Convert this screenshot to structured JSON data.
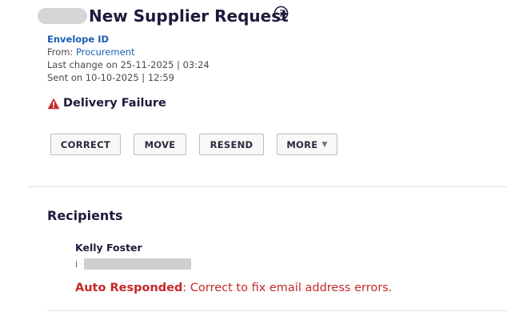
{
  "header": {
    "title": "New Supplier Request",
    "envelope_id_label": "Envelope ID",
    "from_label": "From: ",
    "from_value": "Procurement",
    "last_change": "Last change on 25-11-2025 | 03:24",
    "sent_on": "Sent on 10-10-2025 | 12:59"
  },
  "status": {
    "label": "Delivery Failure",
    "icon": "warning-icon",
    "color": "#c62828"
  },
  "actions": {
    "correct": "CORRECT",
    "move": "MOVE",
    "resend": "RESEND",
    "more": "MORE"
  },
  "recipients": {
    "heading": "Recipients",
    "items": [
      {
        "name": "Kelly Foster",
        "email_visible_start": "i",
        "status_label": "Auto Responded",
        "status_message": ": Correct to fix email address errors."
      }
    ]
  },
  "colors": {
    "accent": "#1a5fb4",
    "title": "#1e1a3c",
    "error": "#c62828"
  }
}
